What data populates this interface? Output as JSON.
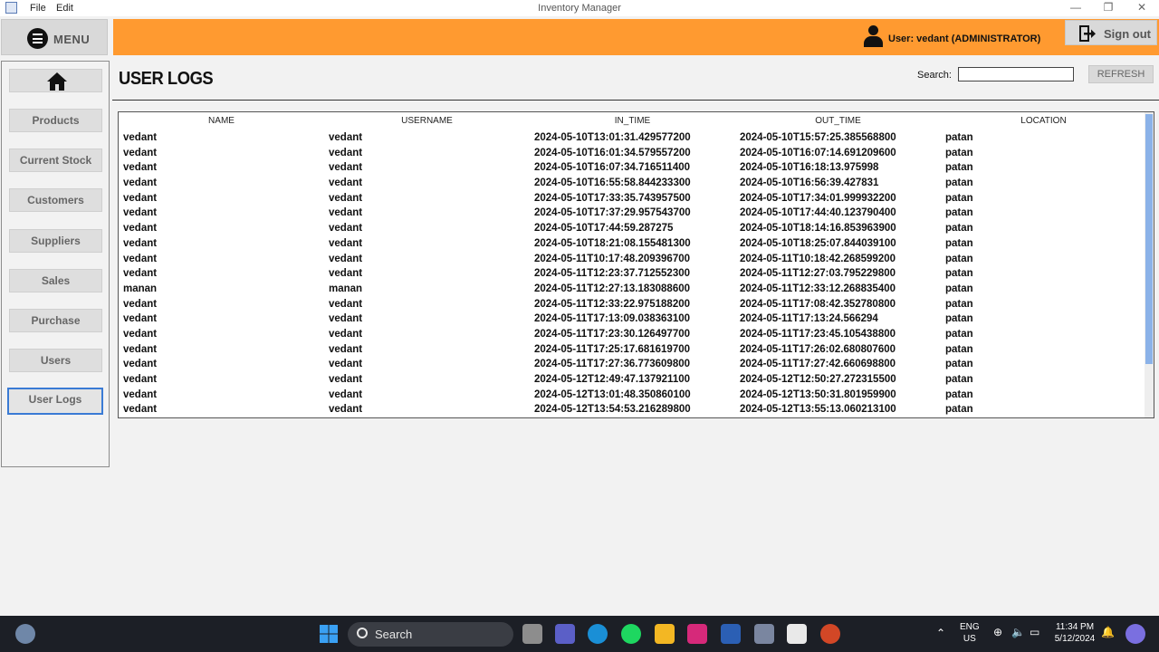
{
  "window": {
    "title": "Inventory Manager",
    "menus": [
      "File",
      "Edit"
    ]
  },
  "header": {
    "menu_label": "MENU",
    "user_text": "User: vedant (ADMINISTRATOR)",
    "signout_label": "Sign out",
    "accent_color": "#ff9a30"
  },
  "sidebar": {
    "items": [
      {
        "label": "Products"
      },
      {
        "label": "Current Stock"
      },
      {
        "label": "Customers"
      },
      {
        "label": "Suppliers"
      },
      {
        "label": "Sales"
      },
      {
        "label": "Purchase"
      },
      {
        "label": "Users"
      },
      {
        "label": "User Logs"
      }
    ],
    "active": "User Logs"
  },
  "main": {
    "title": "USER LOGS",
    "search_label": "Search:",
    "search_value": "",
    "refresh_label": "REFRESH",
    "columns": [
      "NAME",
      "USERNAME",
      "IN_TIME",
      "OUT_TIME",
      "LOCATION"
    ],
    "rows": [
      [
        "vedant",
        "vedant",
        "2024-05-10T13:01:31.429577200",
        "2024-05-10T15:57:25.385568800",
        "patan"
      ],
      [
        "vedant",
        "vedant",
        "2024-05-10T16:01:34.579557200",
        "2024-05-10T16:07:14.691209600",
        "patan"
      ],
      [
        "vedant",
        "vedant",
        "2024-05-10T16:07:34.716511400",
        "2024-05-10T16:18:13.975998",
        "patan"
      ],
      [
        "vedant",
        "vedant",
        "2024-05-10T16:55:58.844233300",
        "2024-05-10T16:56:39.427831",
        "patan"
      ],
      [
        "vedant",
        "vedant",
        "2024-05-10T17:33:35.743957500",
        "2024-05-10T17:34:01.999932200",
        "patan"
      ],
      [
        "vedant",
        "vedant",
        "2024-05-10T17:37:29.957543700",
        "2024-05-10T17:44:40.123790400",
        "patan"
      ],
      [
        "vedant",
        "vedant",
        "2024-05-10T17:44:59.287275",
        "2024-05-10T18:14:16.853963900",
        "patan"
      ],
      [
        "vedant",
        "vedant",
        "2024-05-10T18:21:08.155481300",
        "2024-05-10T18:25:07.844039100",
        "patan"
      ],
      [
        "vedant",
        "vedant",
        "2024-05-11T10:17:48.209396700",
        "2024-05-11T10:18:42.268599200",
        "patan"
      ],
      [
        "vedant",
        "vedant",
        "2024-05-11T12:23:37.712552300",
        "2024-05-11T12:27:03.795229800",
        "patan"
      ],
      [
        "manan",
        "manan",
        "2024-05-11T12:27:13.183088600",
        "2024-05-11T12:33:12.268835400",
        "patan"
      ],
      [
        "vedant",
        "vedant",
        "2024-05-11T12:33:22.975188200",
        "2024-05-11T17:08:42.352780800",
        "patan"
      ],
      [
        "vedant",
        "vedant",
        "2024-05-11T17:13:09.038363100",
        "2024-05-11T17:13:24.566294",
        "patan"
      ],
      [
        "vedant",
        "vedant",
        "2024-05-11T17:23:30.126497700",
        "2024-05-11T17:23:45.105438800",
        "patan"
      ],
      [
        "vedant",
        "vedant",
        "2024-05-11T17:25:17.681619700",
        "2024-05-11T17:26:02.680807600",
        "patan"
      ],
      [
        "vedant",
        "vedant",
        "2024-05-11T17:27:36.773609800",
        "2024-05-11T17:27:42.660698800",
        "patan"
      ],
      [
        "vedant",
        "vedant",
        "2024-05-12T12:49:47.137921100",
        "2024-05-12T12:50:27.272315500",
        "patan"
      ],
      [
        "vedant",
        "vedant",
        "2024-05-12T13:01:48.350860100",
        "2024-05-12T13:50:31.801959900",
        "patan"
      ],
      [
        "vedant",
        "vedant",
        "2024-05-12T13:54:53.216289800",
        "2024-05-12T13:55:13.060213100",
        "patan"
      ]
    ]
  },
  "taskbar": {
    "search_label": "Search",
    "lang": "ENG",
    "region": "US",
    "time": "11:34 PM",
    "date": "5/12/2024"
  }
}
